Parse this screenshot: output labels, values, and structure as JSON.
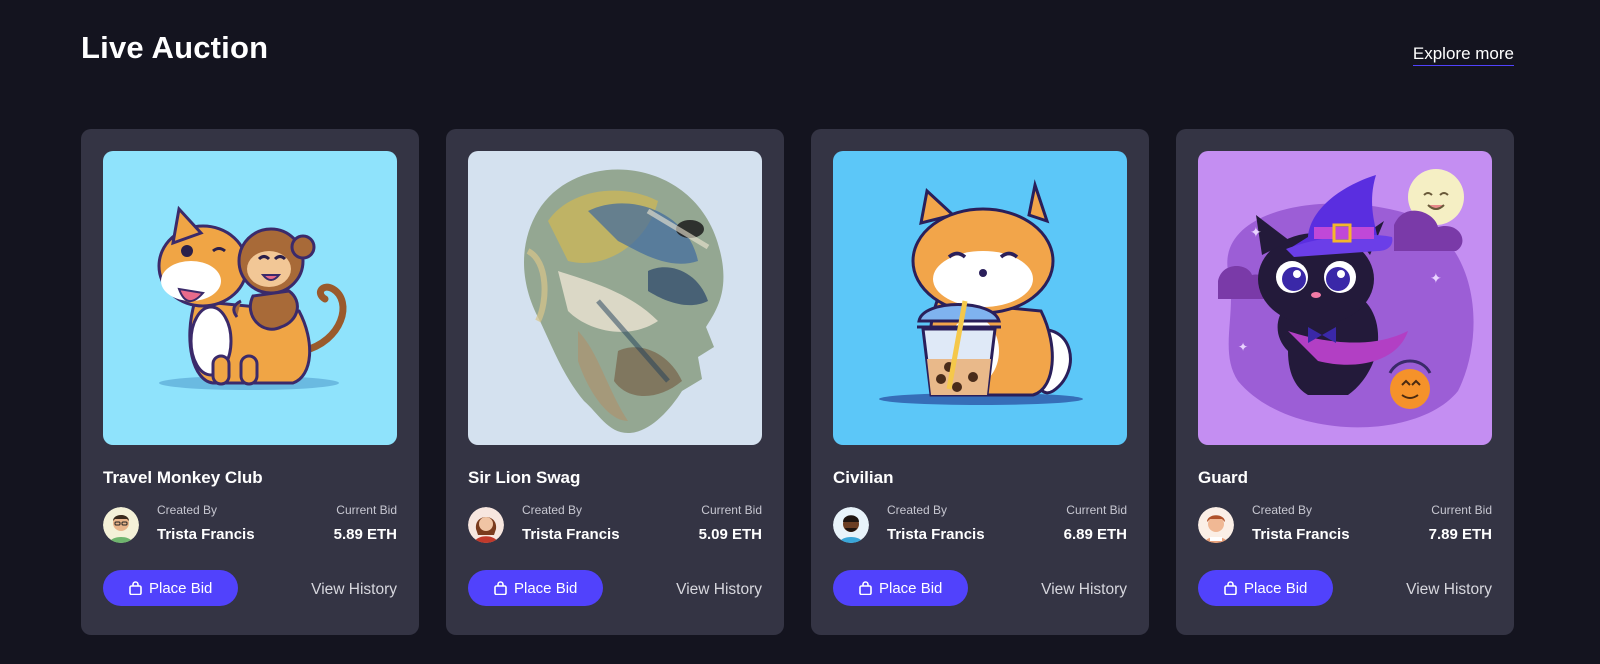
{
  "section": {
    "title": "Live Auction",
    "explore_label": "Explore more"
  },
  "cards": [
    {
      "title": "Travel Monkey Club",
      "created_by_label": "Created By",
      "creator": "Trista Francis",
      "current_bid_label": "Current Bid",
      "bid": "5.89 ETH",
      "place_bid_label": "Place Bid",
      "history_label": "View History",
      "image": "shiba-and-monkey-illustration",
      "image_bg": "#8fe3fc"
    },
    {
      "title": "Sir Lion Swag",
      "created_by_label": "Created By",
      "creator": "Trista Francis",
      "current_bid_label": "Current Bid",
      "bid": "5.09 ETH",
      "place_bid_label": "Place Bid",
      "history_label": "View History",
      "image": "painted-skull-sculpture",
      "image_bg": "#d4e1ef"
    },
    {
      "title": "Civilian",
      "created_by_label": "Created By",
      "creator": "Trista Francis",
      "current_bid_label": "Current Bid",
      "bid": "6.89 ETH",
      "place_bid_label": "Place Bid",
      "history_label": "View History",
      "image": "shiba-drinking-boba-illustration",
      "image_bg": "#5cc7f8"
    },
    {
      "title": "Guard",
      "created_by_label": "Created By",
      "creator": "Trista Francis",
      "current_bid_label": "Current Bid",
      "bid": "7.89 ETH",
      "place_bid_label": "Place Bid",
      "history_label": "View History",
      "image": "witch-cat-illustration",
      "image_bg": "#c48ef2"
    }
  ],
  "colors": {
    "background": "#14141f",
    "card": "#343444",
    "accent": "#5142fc",
    "text": "#ffffff",
    "muted": "#c7c7d1"
  },
  "icons": {
    "button_icon": "shopping-bag-icon"
  }
}
